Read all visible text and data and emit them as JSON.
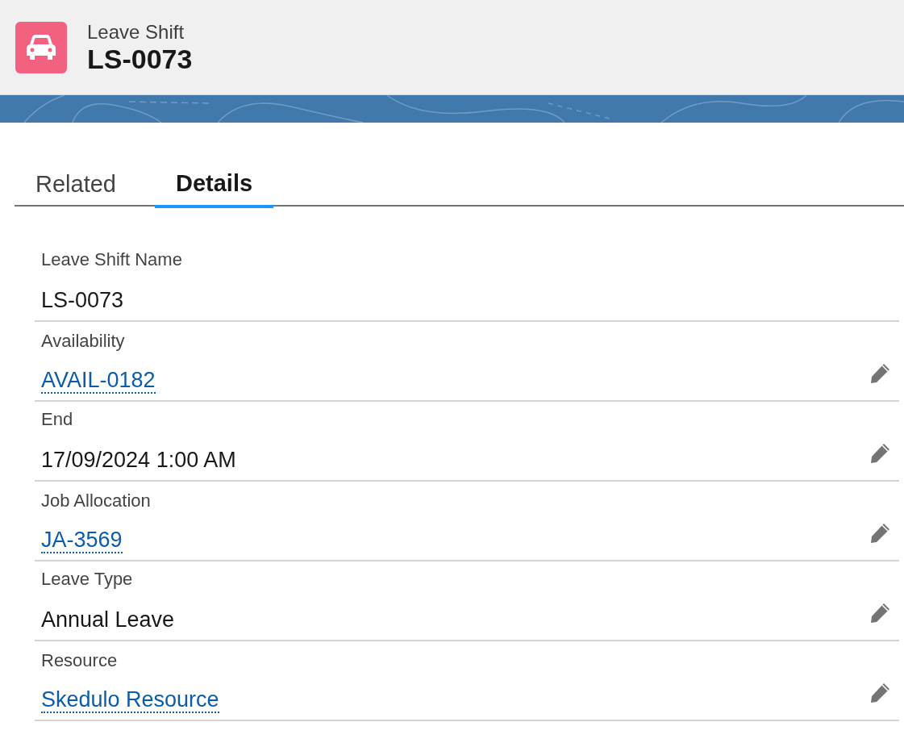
{
  "header": {
    "object_type": "Leave Shift",
    "title": "LS-0073"
  },
  "tabs": [
    {
      "label": "Related",
      "selected": false
    },
    {
      "label": "Details",
      "selected": true
    }
  ],
  "fields": [
    {
      "label": "Leave Shift Name",
      "value": "LS-0073",
      "kind": "text",
      "editable": false
    },
    {
      "label": "Availability",
      "value": "AVAIL-0182",
      "kind": "link",
      "editable": true
    },
    {
      "label": "End",
      "value": "17/09/2024 1:00 AM",
      "kind": "text",
      "editable": true
    },
    {
      "label": "Job Allocation",
      "value": "JA-3569",
      "kind": "link",
      "editable": true
    },
    {
      "label": "Leave Type",
      "value": "Annual Leave",
      "kind": "text",
      "editable": true
    },
    {
      "label": "Resource",
      "value": "Skedulo Resource",
      "kind": "link",
      "editable": true
    }
  ]
}
